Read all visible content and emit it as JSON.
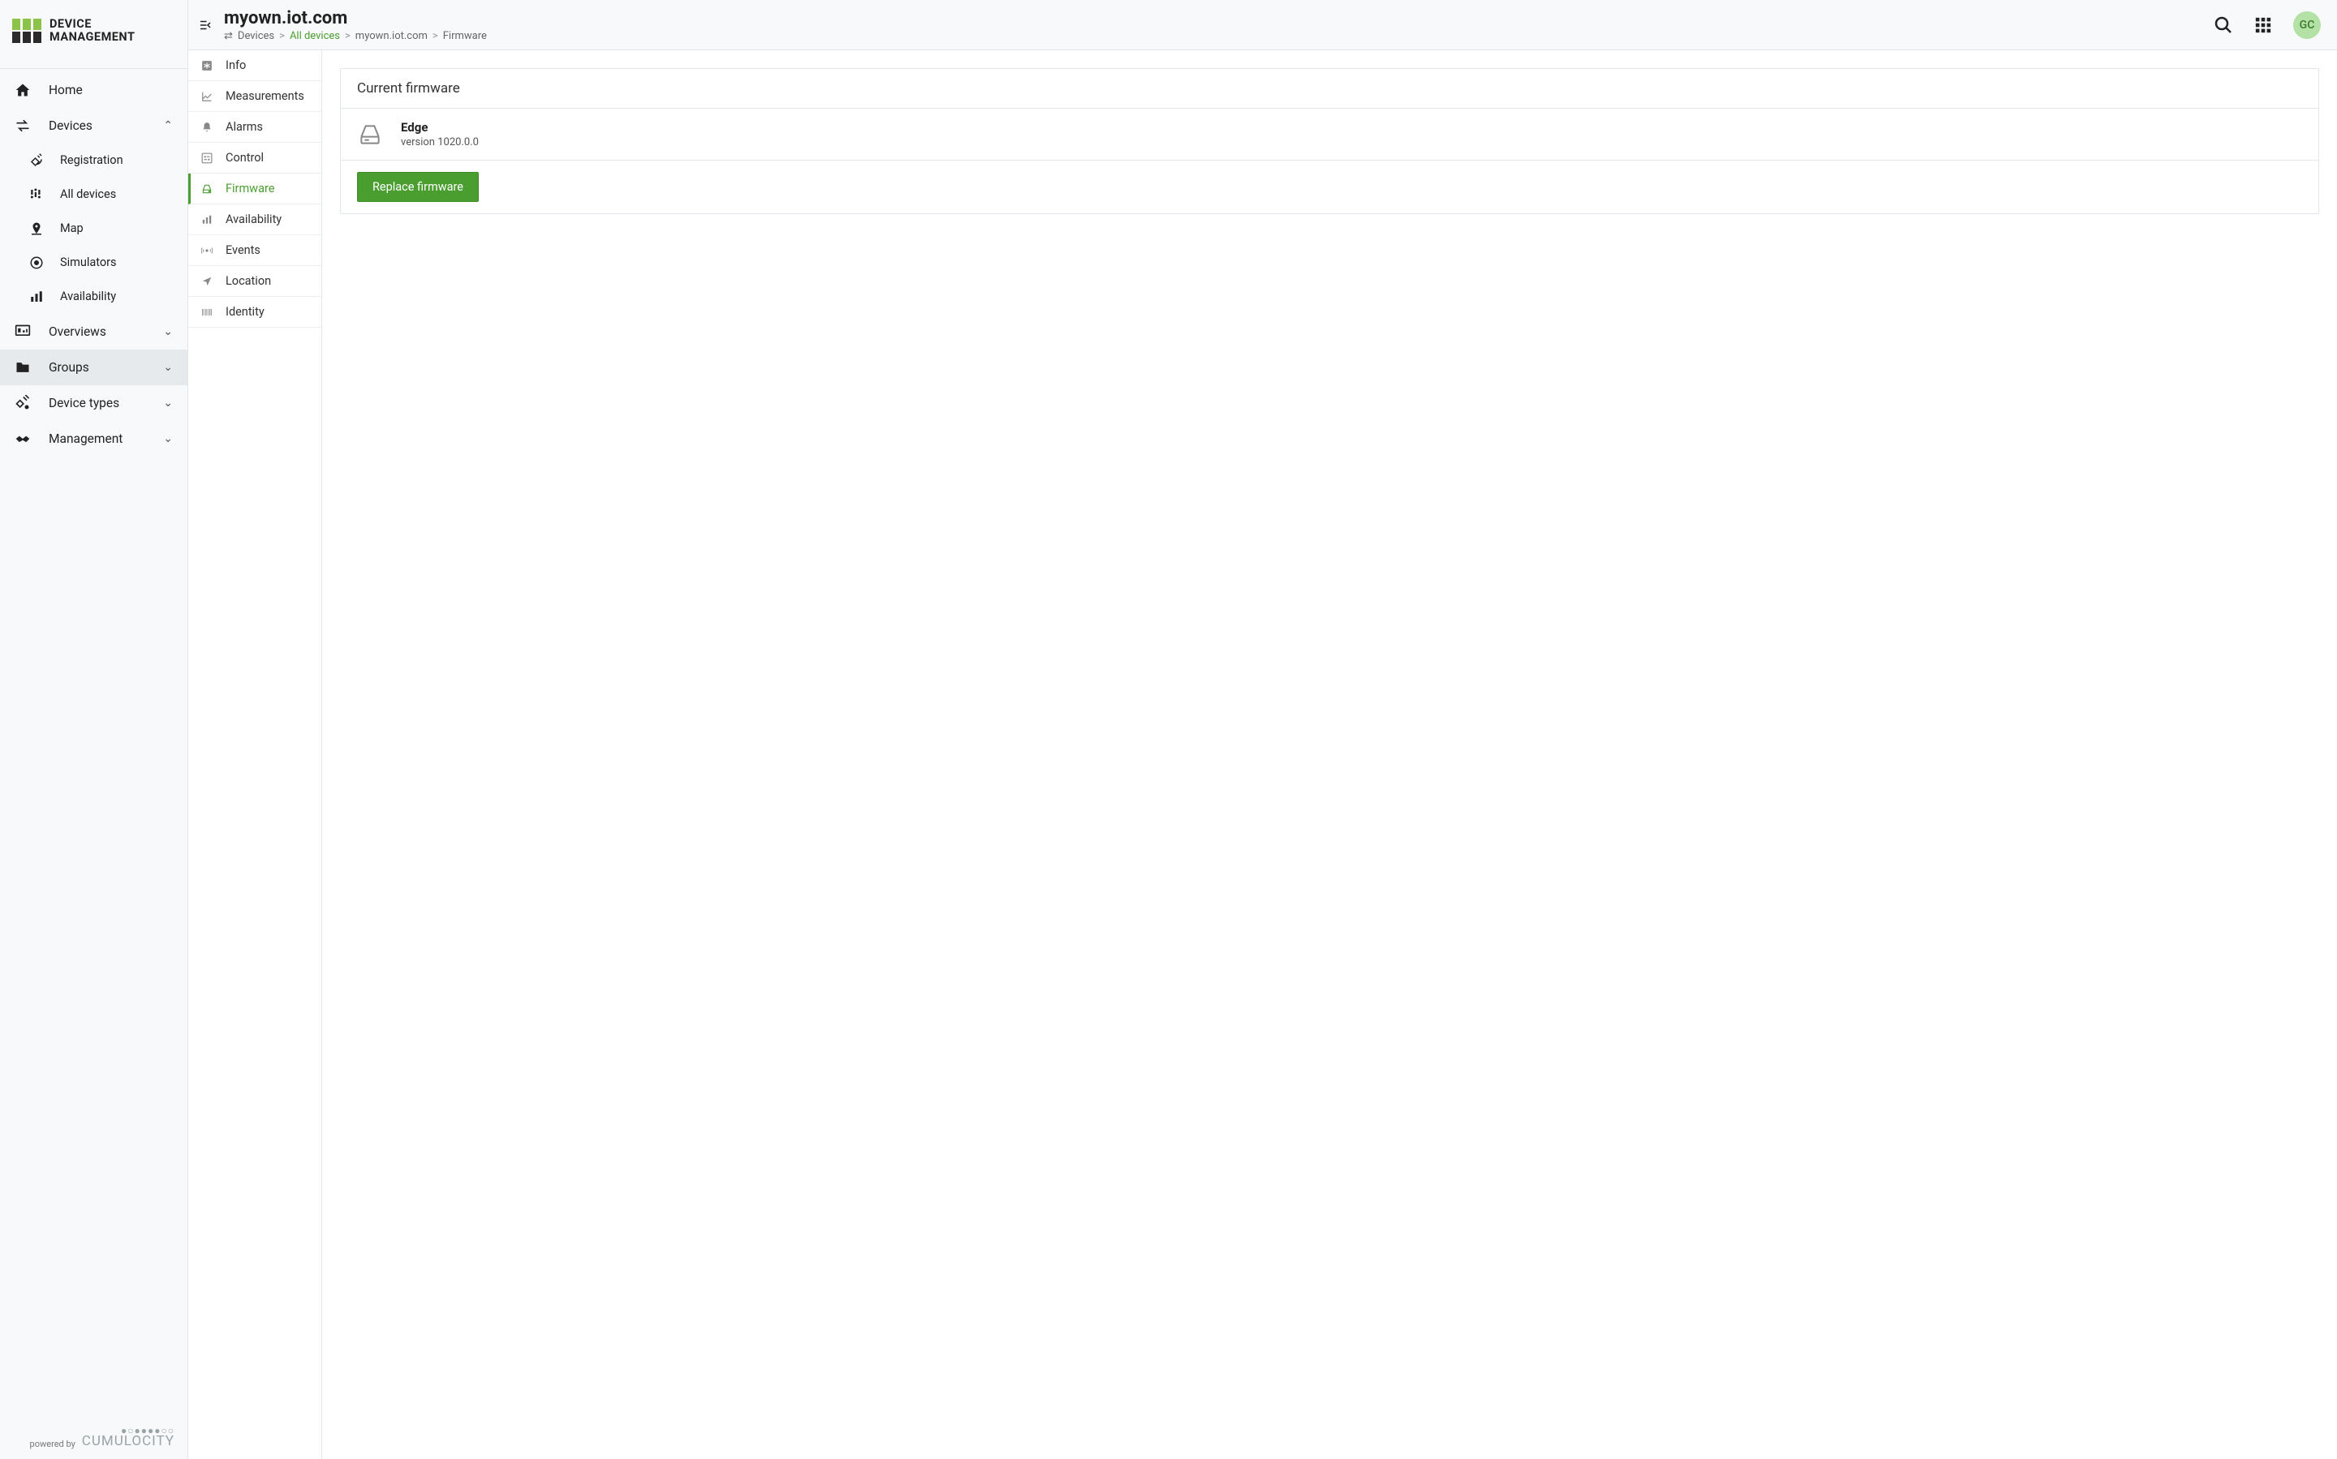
{
  "app": {
    "logo_line1": "DEVICE",
    "logo_line2": "MANAGEMENT",
    "powered_by": "powered by",
    "brand": "CUMULOCITY"
  },
  "sidebar": {
    "items": [
      {
        "label": "Home",
        "icon": "home"
      },
      {
        "label": "Devices",
        "icon": "swap",
        "expanded": true,
        "children": [
          {
            "label": "Registration",
            "icon": "satellite"
          },
          {
            "label": "All devices",
            "icon": "sliders"
          },
          {
            "label": "Map",
            "icon": "map-pin"
          },
          {
            "label": "Simulators",
            "icon": "target"
          },
          {
            "label": "Availability",
            "icon": "bars"
          }
        ]
      },
      {
        "label": "Overviews",
        "icon": "dashboard",
        "expanded": false
      },
      {
        "label": "Groups",
        "icon": "folder",
        "expanded": false,
        "hover": true
      },
      {
        "label": "Device types",
        "icon": "satellite2",
        "expanded": false
      },
      {
        "label": "Management",
        "icon": "handshake",
        "expanded": false
      }
    ]
  },
  "tabs": [
    {
      "label": "Info",
      "icon": "asterisk"
    },
    {
      "label": "Measurements",
      "icon": "chart-line"
    },
    {
      "label": "Alarms",
      "icon": "bell"
    },
    {
      "label": "Control",
      "icon": "sliders-box"
    },
    {
      "label": "Firmware",
      "icon": "hdd",
      "active": true
    },
    {
      "label": "Availability",
      "icon": "bars"
    },
    {
      "label": "Events",
      "icon": "broadcast"
    },
    {
      "label": "Location",
      "icon": "navigation"
    },
    {
      "label": "Identity",
      "icon": "barcode"
    }
  ],
  "header": {
    "title": "myown.iot.com",
    "breadcrumb": {
      "root": "Devices",
      "link": "All devices",
      "entity": "myown.iot.com",
      "page": "Firmware",
      "sep": ">"
    },
    "avatar": "GC"
  },
  "firmware": {
    "card_title": "Current firmware",
    "name": "Edge",
    "version_label": "version 1020.0.0",
    "replace_button": "Replace firmware"
  }
}
